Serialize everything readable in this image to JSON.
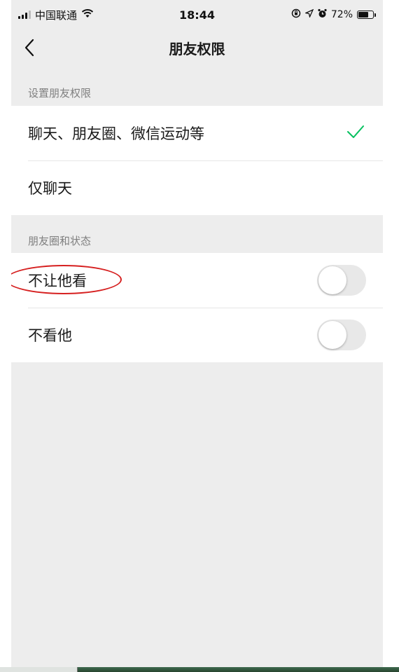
{
  "status": {
    "carrier": "中国联通",
    "time": "18:44",
    "battery": "72%",
    "battery_level": 0.72
  },
  "nav": {
    "title": "朋友权限",
    "back_icon": "chevron-left-icon"
  },
  "permissions": {
    "section_label": "设置朋友权限",
    "options": [
      {
        "label": "聊天、朋友圈、微信运动等",
        "selected": true
      },
      {
        "label": "仅聊天",
        "selected": false
      }
    ]
  },
  "moments": {
    "section_label": "朋友圈和状态",
    "items": [
      {
        "label": "不让他看",
        "on": false
      },
      {
        "label": "不看他",
        "on": false
      }
    ]
  },
  "colors": {
    "check": "#07c160",
    "background": "#ededed",
    "annotation": "#d62020"
  }
}
